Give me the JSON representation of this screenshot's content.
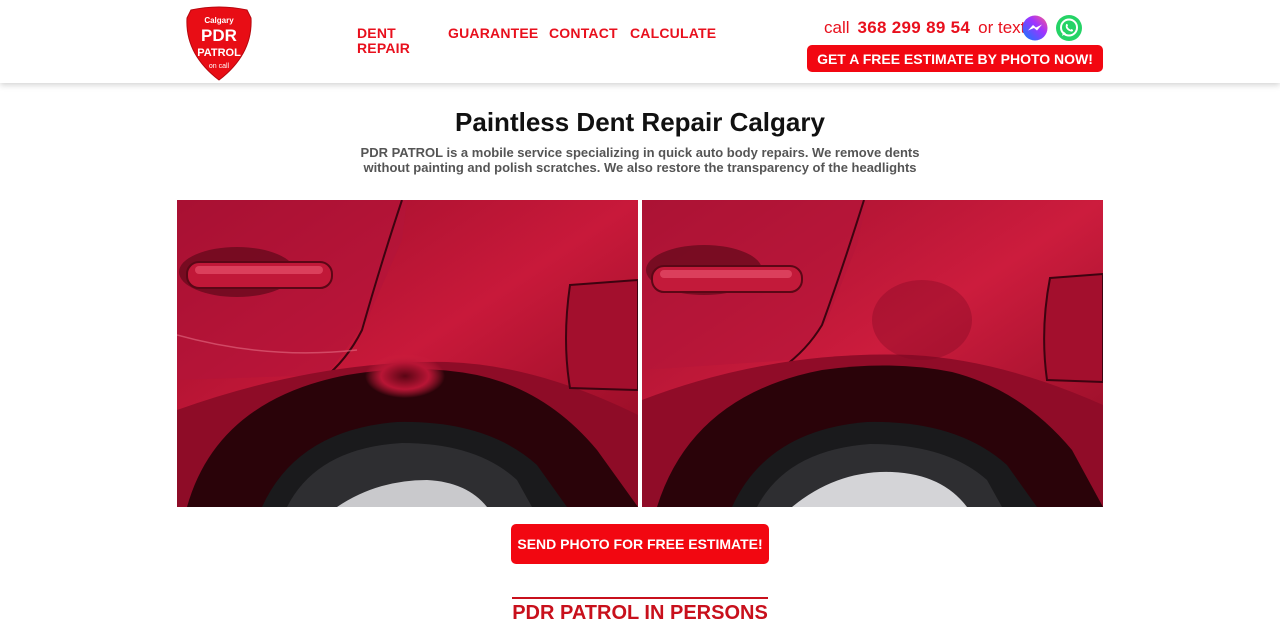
{
  "header": {
    "logo": {
      "city": "Calgary",
      "line1": "PDR",
      "line2": "PATROL",
      "line3": "on call"
    },
    "nav": [
      {
        "label_line1": "DENT",
        "label_line2": "REPAIR"
      },
      {
        "label_line1": "GUARANTEE",
        "label_line2": ""
      },
      {
        "label_line1": "CONTACT",
        "label_line2": ""
      },
      {
        "label_line1": "CALCULATE",
        "label_line2": ""
      }
    ],
    "contact": {
      "call_label": "call",
      "phone": "368 299 89 54",
      "or_text_label": "or text"
    },
    "estimate_button": "GET A FREE ESTIMATE BY PHOTO NOW!",
    "icons": {
      "messenger": "messenger-icon",
      "whatsapp": "whatsapp-icon"
    }
  },
  "main": {
    "title": "Paintless Dent Repair Calgary",
    "subtitle": "PDR PATROL is a mobile service specializing in quick auto body repairs. We remove dents without painting and polish scratches. We also restore the transparency of the headlights",
    "photos": [
      {
        "name": "before-repair-photo"
      },
      {
        "name": "after-repair-photo"
      }
    ],
    "send_button": "SEND PHOTO FOR FREE ESTIMATE!",
    "section_title": "PDR PATROL IN PERSONS"
  },
  "colors": {
    "brand_red": "#f20711",
    "text_red": "#e8101d",
    "car_red": "#a80f2c"
  }
}
